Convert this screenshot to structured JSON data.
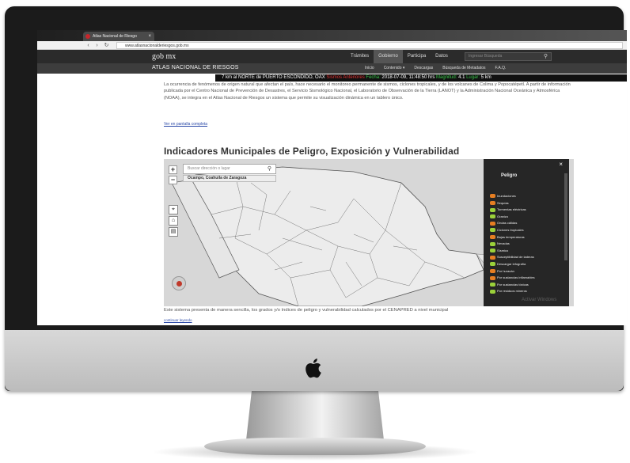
{
  "browser": {
    "tab_title": "Atlas Nacional de Riesgo",
    "url": "www.atlasnacionalderiesgos.gob.mx"
  },
  "gob": {
    "logo": "gob mx",
    "nav": [
      "Trámites",
      "Gobierno",
      "Participa",
      "Datos"
    ],
    "active_nav": "Gobierno",
    "search_placeholder": "Ingresar Búsqueda"
  },
  "atlas": {
    "title": "ATLAS NACIONAL DE RIESGOS",
    "menu": [
      "Inicio",
      "Contenido ▾",
      "Descargas",
      "Búsqueda de Metadatos",
      "F.A.Q."
    ]
  },
  "ticker": {
    "lead": "7 km al NORTE de PUERTO ESCONDIDO, OAX",
    "label1": "Sismos Anteriores",
    "label2": "Fecha:",
    "date": "2018-07-09, 11:48:50 hrs",
    "label3": "Magnitud:",
    "magnitude": "4.1",
    "label4": "Lugar:",
    "tail": "5 km"
  },
  "content": {
    "paragraph": "La ocurrencia de fenómenos de origen natural que afectan el país, hace necesario el monitoreo permanente de sismos, ciclones tropicales, y de los volcanes de Colima y Popocatépetl. A partir de información publicada por el Centro Nacional de Prevención de Desastres, el Servicio Sismológico Nacional, el Laboratorio de Observación de la Tierra (LANOT) y la Administración Nacional Oceánica y Atmosférica (NOAA), se integra en el Atlas Nacional de Riesgos un sistema que permite su visualización dinámica en un tablero único.",
    "more_link": "Ver en pantalla completa",
    "heading": "Indicadores Municipales de Peligro, Exposición y Vulnerabilidad",
    "caption": "Este sistema presenta de manera sencilla, los grados y/o índices de peligro y vulnerabilidad calculados por el CENAPRED a nivel municipal",
    "caption_link": "continuar leyendo"
  },
  "map": {
    "search_placeholder": "Buscar dirección o lugar",
    "selected_place": "Ocampo, Coahuila de Zaragoza",
    "zoom_in": "+",
    "zoom_out": "−",
    "panel_title": "Peligro",
    "panel_close": "×",
    "layers": [
      {
        "label": "Inundaciones",
        "color": "#e67e22"
      },
      {
        "label": "Sequías",
        "color": "#e67e22"
      },
      {
        "label": "Tormentas eléctricas",
        "color": "#9bd13a"
      },
      {
        "label": "Granizo",
        "color": "#9bd13a"
      },
      {
        "label": "Ondas cálidas",
        "color": "#e67e22"
      },
      {
        "label": "Ciclones tropicales",
        "color": "#9bd13a"
      },
      {
        "label": "Bajas temperaturas",
        "color": "#e67e22"
      },
      {
        "label": "Nevadas",
        "color": "#9bd13a"
      },
      {
        "label": "Sísmico",
        "color": "#9bd13a"
      },
      {
        "label": "Susceptibilidad de laderas",
        "color": "#e67e22"
      },
      {
        "label": "Descargar infografía",
        "color": "#9bd13a"
      },
      {
        "label": "Por huracán",
        "color": "#e67e22"
      },
      {
        "label": "Por sustancias inflamables",
        "color": "#e67e22"
      },
      {
        "label": "Por sustancias tóxicas",
        "color": "#9bd13a"
      },
      {
        "label": "Por residuos mineros",
        "color": "#9bd13a"
      }
    ]
  },
  "watermark": "Activar Windows"
}
